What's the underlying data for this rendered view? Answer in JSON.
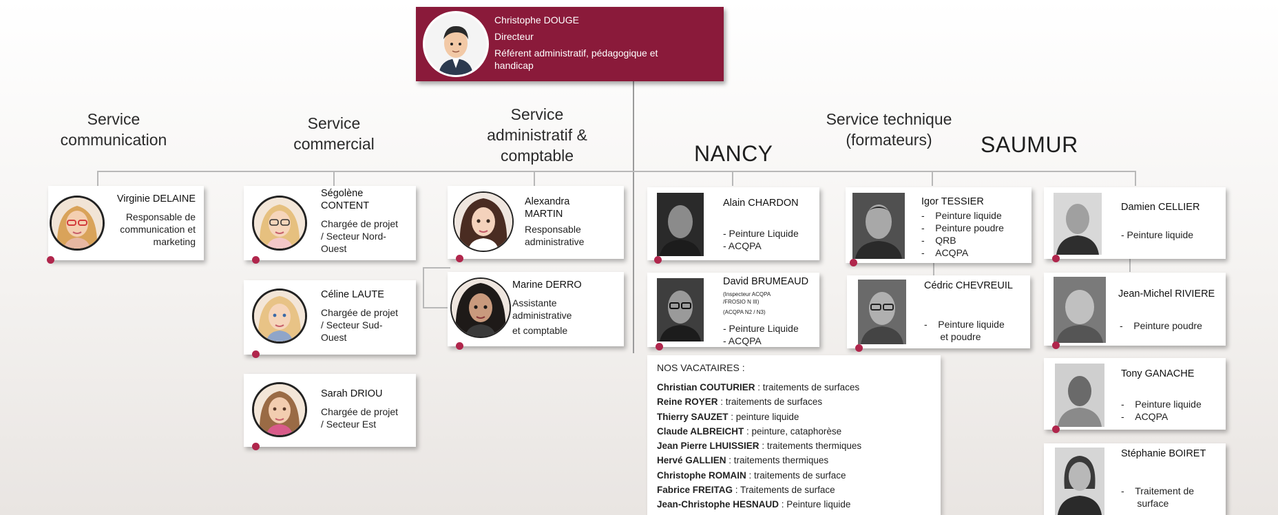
{
  "director": {
    "name": "Christophe DOUGE",
    "title": "Directeur",
    "role_line1": "Référent administratif, pédagogique et",
    "role_line2": "handicap"
  },
  "headings": {
    "communication": [
      "Service",
      "communication"
    ],
    "commercial": [
      "Service",
      "commercial"
    ],
    "administratif": [
      "Service",
      "administratif &",
      "comptable"
    ],
    "technique": [
      "Service technique",
      "(formateurs)"
    ],
    "nancy": "NANCY",
    "saumur": "SAUMUR"
  },
  "people": {
    "delaine": {
      "name": "Virginie DELAINE",
      "role": [
        "Responsable de",
        "communication et",
        "marketing"
      ]
    },
    "content": {
      "name": [
        "Ségolène",
        "CONTENT"
      ],
      "role": [
        "Chargée de projet",
        "/ Secteur Nord-",
        "Ouest"
      ]
    },
    "laute": {
      "name": "Céline LAUTE",
      "role": [
        "Chargée de projet",
        "/ Secteur Sud-",
        "Ouest"
      ]
    },
    "driou": {
      "name": "Sarah DRIOU",
      "role": [
        "Chargée de projet",
        "/ Secteur Est"
      ]
    },
    "martin": {
      "name": [
        "Alexandra",
        "MARTIN"
      ],
      "role": [
        "Responsable",
        "administrative"
      ]
    },
    "derro": {
      "name": "Marine DERRO",
      "role": [
        "Assistante",
        "administrative",
        "et comptable"
      ]
    },
    "chardon": {
      "name": "Alain CHARDON",
      "role": [
        "- Peinture Liquide",
        "- ACQPA"
      ]
    },
    "brumeaud": {
      "name": "David BRUMEAUD",
      "small": [
        "(Inspecteur ACQPA",
        "/FROSIO N III)",
        "(ACQPA N2 / N3)"
      ],
      "role": [
        "- Peinture Liquide",
        "- ACQPA"
      ]
    },
    "tessier": {
      "name": "Igor TESSIER",
      "role": [
        "Peinture liquide",
        "Peinture poudre",
        "QRB",
        "ACQPA"
      ]
    },
    "chevreuil": {
      "name": "Cédric CHEVREUIL",
      "role": [
        "Peinture liquide",
        "et poudre"
      ]
    },
    "cellier": {
      "name": "Damien CELLIER",
      "role": [
        "- Peinture liquide"
      ]
    },
    "riviere": {
      "name": "Jean-Michel RIVIERE",
      "role": [
        "Peinture poudre"
      ]
    },
    "ganache": {
      "name": "Tony GANACHE",
      "role": [
        "Peinture liquide",
        "ACQPA"
      ]
    },
    "boiret": {
      "name": "Stéphanie BOIRET",
      "role": [
        "Traitement de",
        "surface"
      ]
    }
  },
  "vacataires": {
    "title": "NOS VACATAIRES :",
    "items": [
      {
        "name": "Christian COUTURIER",
        "desc": " : traitements de surfaces"
      },
      {
        "name": "Reine ROYER",
        "desc": " : traitements de surfaces"
      },
      {
        "name": "Thierry SAUZET",
        "desc": " : peinture liquide"
      },
      {
        "name": "Claude ALBREICHT",
        "desc": " : peinture, cataphorèse"
      },
      {
        "name": "Jean Pierre LHUISSIER",
        "desc": " : traitements thermiques"
      },
      {
        "name": "Hervé GALLIEN",
        "desc": " : traitements thermiques"
      },
      {
        "name": "Christophe ROMAIN",
        "desc": " : traitements de surface"
      },
      {
        "name": "Fabrice FREITAG",
        "desc": " : Traitements de surface"
      },
      {
        "name": "Jean-Christophe HESNAUD",
        "desc": " : Peinture liquide"
      }
    ]
  },
  "colors": {
    "accent": "#8a1a3a",
    "dot": "#b0264c",
    "connector": "#b8b8b8"
  }
}
